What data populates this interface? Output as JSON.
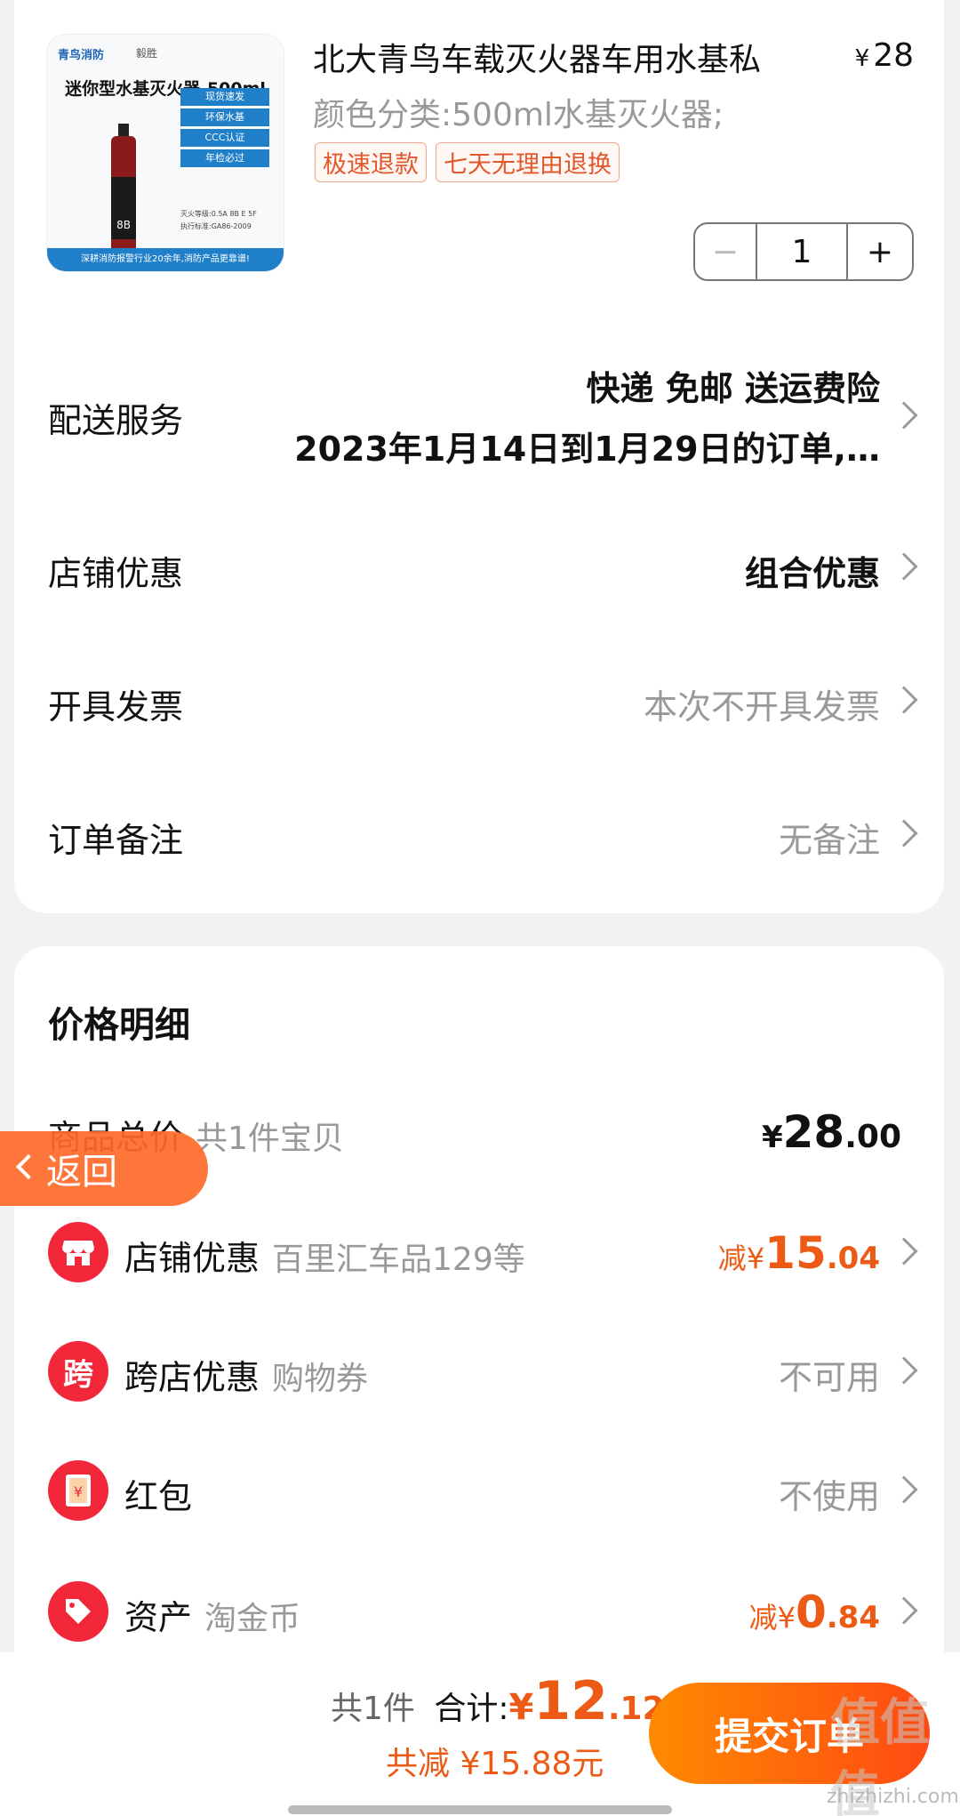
{
  "product": {
    "image": {
      "brand": "青鸟消防",
      "brand2": "毅胜",
      "title": "迷你型水基灭火器-500ml",
      "features": [
        "现货速发",
        "环保水基",
        "CCC认证",
        "年检必过"
      ],
      "bottle_label": "8B",
      "spec1": "灭火等级:0.5A 8B E 5F",
      "spec2": "执行标准:GA86-2009",
      "footer": "深耕消防报警行业20余年,消防产品更靠谱!"
    },
    "title": "北大青鸟车载灭火器车用水基私",
    "price_symbol": "¥",
    "price": "28",
    "variant": "颜色分类:500ml水基灭火器;",
    "tags": [
      "极速退款",
      "七天无理由退换"
    ],
    "quantity": "1",
    "minus": "−",
    "plus": "+"
  },
  "rows": {
    "delivery": {
      "label": "配送服务",
      "line1": "快递 免邮 送运费险",
      "line2": "2023年1月14日到1月29日的订单,…"
    },
    "shop_discount": {
      "label": "店铺优惠",
      "value": "组合优惠"
    },
    "invoice": {
      "label": "开具发票",
      "value": "本次不开具发票"
    },
    "note": {
      "label": "订单备注",
      "value": "无备注"
    }
  },
  "price_detail": {
    "title": "价格明细",
    "total": {
      "label": "商品总价",
      "sub": "共1件宝贝",
      "symbol": "¥",
      "int": "28",
      "dec": ".00"
    },
    "shop": {
      "icon": "shop-icon",
      "label": "店铺优惠",
      "sub": "百里汇车品129等",
      "prefix": "减",
      "symbol": "¥",
      "int": "15",
      "dec": ".04"
    },
    "cross": {
      "icon_text": "跨",
      "label": "跨店优惠",
      "sub": "购物券",
      "value": "不可用"
    },
    "redpacket": {
      "icon": "red-packet-icon",
      "icon_text": "¥",
      "label": "红包",
      "value": "不使用"
    },
    "assets": {
      "icon": "tag-icon",
      "label": "资产",
      "sub": "淘金币",
      "prefix": "减",
      "symbol": "¥",
      "int": "0",
      "dec": ".84"
    }
  },
  "back_button": "返回",
  "bottom": {
    "count": "共1件",
    "total_label": "合计:",
    "symbol": "¥",
    "int": "12",
    "dec": ".12",
    "saved": "共减 ¥15.88元",
    "submit": "提交订单"
  },
  "watermark": "值值值",
  "watermark_url": "zhizhizhi.com",
  "colors": {
    "accent": "#ec5a15",
    "icon_red": "#f2273a",
    "submit_start": "#ff8a00",
    "submit_end": "#ff4a14"
  }
}
